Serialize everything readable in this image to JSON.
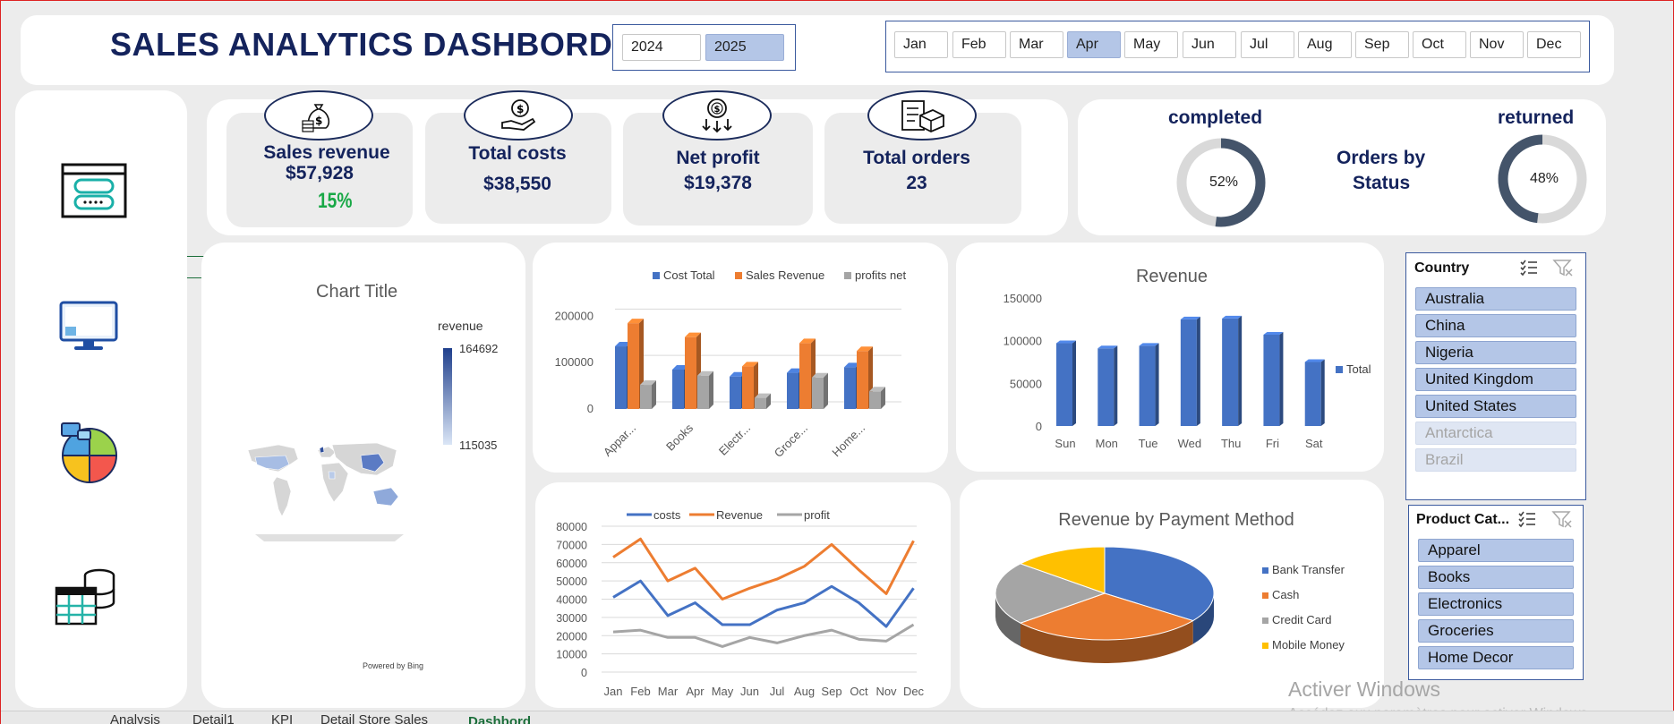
{
  "header": {
    "title": "SALES ANALYTICS DASHBORD",
    "years": [
      {
        "label": "2024",
        "selected": false
      },
      {
        "label": "2025",
        "selected": true
      }
    ],
    "months": [
      {
        "label": "Jan",
        "selected": false
      },
      {
        "label": "Feb",
        "selected": false
      },
      {
        "label": "Mar",
        "selected": false
      },
      {
        "label": "Apr",
        "selected": true
      },
      {
        "label": "May",
        "selected": false
      },
      {
        "label": "Jun",
        "selected": false
      },
      {
        "label": "Jul",
        "selected": false
      },
      {
        "label": "Aug",
        "selected": false
      },
      {
        "label": "Sep",
        "selected": false
      },
      {
        "label": "Oct",
        "selected": false
      },
      {
        "label": "Nov",
        "selected": false
      },
      {
        "label": "Dec",
        "selected": false
      }
    ]
  },
  "sidebar": {
    "icons": [
      "browser-window-icon",
      "monitor-icon",
      "pie-chart-icon",
      "database-table-icon"
    ]
  },
  "kpis": [
    {
      "icon": "money-bag-icon",
      "label": "Sales revenue",
      "value": "$57,928",
      "delta": "15%"
    },
    {
      "icon": "hand-coin-icon",
      "label": "Total costs",
      "value": "$38,550"
    },
    {
      "icon": "coin-arrows-icon",
      "label": "Net profit",
      "value": "$19,378"
    },
    {
      "icon": "clipboard-box-icon",
      "label": "Total orders",
      "value": "23"
    }
  ],
  "status": {
    "completed_label": "completed",
    "completed_value": "52%",
    "returned_label": "returned",
    "returned_value": "48%",
    "center_line1": "Orders by",
    "center_line2": "Status",
    "colors": {
      "filled": "#44546a",
      "track": "#d9d9d9"
    }
  },
  "map": {
    "title": "Chart Title",
    "legend_title": "revenue",
    "max": "164692",
    "min": "115035",
    "credit": "Powered by Bing"
  },
  "slicers": {
    "country": {
      "title": "Country",
      "items": [
        {
          "label": "Australia",
          "active": true
        },
        {
          "label": "China",
          "active": true
        },
        {
          "label": "Nigeria",
          "active": true
        },
        {
          "label": "United Kingdom",
          "active": true
        },
        {
          "label": "United States",
          "active": true
        },
        {
          "label": "Antarctica",
          "active": false
        },
        {
          "label": "Brazil",
          "active": false
        }
      ]
    },
    "category": {
      "title": "Product Cat...",
      "items": [
        {
          "label": "Apparel",
          "active": true
        },
        {
          "label": "Books",
          "active": true
        },
        {
          "label": "Electronics",
          "active": true
        },
        {
          "label": "Groceries",
          "active": true
        },
        {
          "label": "Home Decor",
          "active": true
        }
      ]
    }
  },
  "watermark": {
    "line1": "Activer Windows",
    "line2": "Accédez aux paramètres pour activer Windows."
  },
  "tabs": [
    "Analysis",
    "Detail1",
    "KPI",
    "Detail Store Sales",
    "Dashbord"
  ],
  "chart_data": [
    {
      "id": "category-bar",
      "type": "bar",
      "categories": [
        "Appar...",
        "Books",
        "Electr...",
        "Groce...",
        "Home..."
      ],
      "series": [
        {
          "name": "Cost Total",
          "color": "#4472c4",
          "values": [
            135000,
            85000,
            70000,
            78000,
            90000
          ]
        },
        {
          "name": "Sales Revenue",
          "color": "#ed7d31",
          "values": [
            185000,
            155000,
            92000,
            142000,
            125000
          ]
        },
        {
          "name": "profits net",
          "color": "#a5a5a5",
          "values": [
            52000,
            72000,
            24000,
            68000,
            38000
          ]
        }
      ],
      "yticks": [
        0,
        100000,
        200000
      ],
      "ylim": [
        0,
        220000
      ],
      "legend": "top"
    },
    {
      "id": "revenue-weekday",
      "type": "bar",
      "title": "Revenue",
      "categories": [
        "Sun",
        "Mon",
        "Tue",
        "Wed",
        "Thu",
        "Fri",
        "Sat"
      ],
      "series": [
        {
          "name": "Total",
          "color": "#4472c4",
          "values": [
            97000,
            91000,
            94000,
            125000,
            126000,
            107000,
            75000
          ]
        }
      ],
      "yticks": [
        0,
        50000,
        100000,
        150000
      ],
      "ylim": [
        0,
        150000
      ],
      "legend": "right"
    },
    {
      "id": "monthly-line",
      "type": "line",
      "categories": [
        "Jan",
        "Feb",
        "Mar",
        "Apr",
        "May",
        "Jun",
        "Jul",
        "Aug",
        "Sep",
        "Oct",
        "Nov",
        "Dec"
      ],
      "series": [
        {
          "name": "costs",
          "color": "#4472c4",
          "values": [
            41000,
            50000,
            31000,
            38000,
            26000,
            26000,
            34000,
            38000,
            47000,
            38000,
            25000,
            46000
          ]
        },
        {
          "name": "Revenue",
          "color": "#ed7d31",
          "values": [
            63000,
            73000,
            50000,
            57000,
            40000,
            46000,
            51000,
            58000,
            70000,
            56000,
            43000,
            72000
          ]
        },
        {
          "name": "profit",
          "color": "#a5a5a5",
          "values": [
            22000,
            23000,
            19000,
            19000,
            14000,
            19000,
            16000,
            20000,
            23000,
            18000,
            17000,
            26000
          ]
        }
      ],
      "yticks": [
        0,
        10000,
        20000,
        30000,
        40000,
        50000,
        60000,
        70000,
        80000
      ],
      "ylim": [
        0,
        80000
      ],
      "legend": "top"
    },
    {
      "id": "payment-pie",
      "type": "pie",
      "title": "Revenue by Payment Method",
      "slices": [
        {
          "name": "Bank Transfer",
          "color": "#4472c4",
          "value": 35
        },
        {
          "name": "Cash",
          "color": "#ed7d31",
          "value": 29
        },
        {
          "name": "Credit Card",
          "color": "#a5a5a5",
          "value": 22
        },
        {
          "name": "Mobile Money",
          "color": "#ffc000",
          "value": 14
        }
      ],
      "legend": "right"
    }
  ]
}
